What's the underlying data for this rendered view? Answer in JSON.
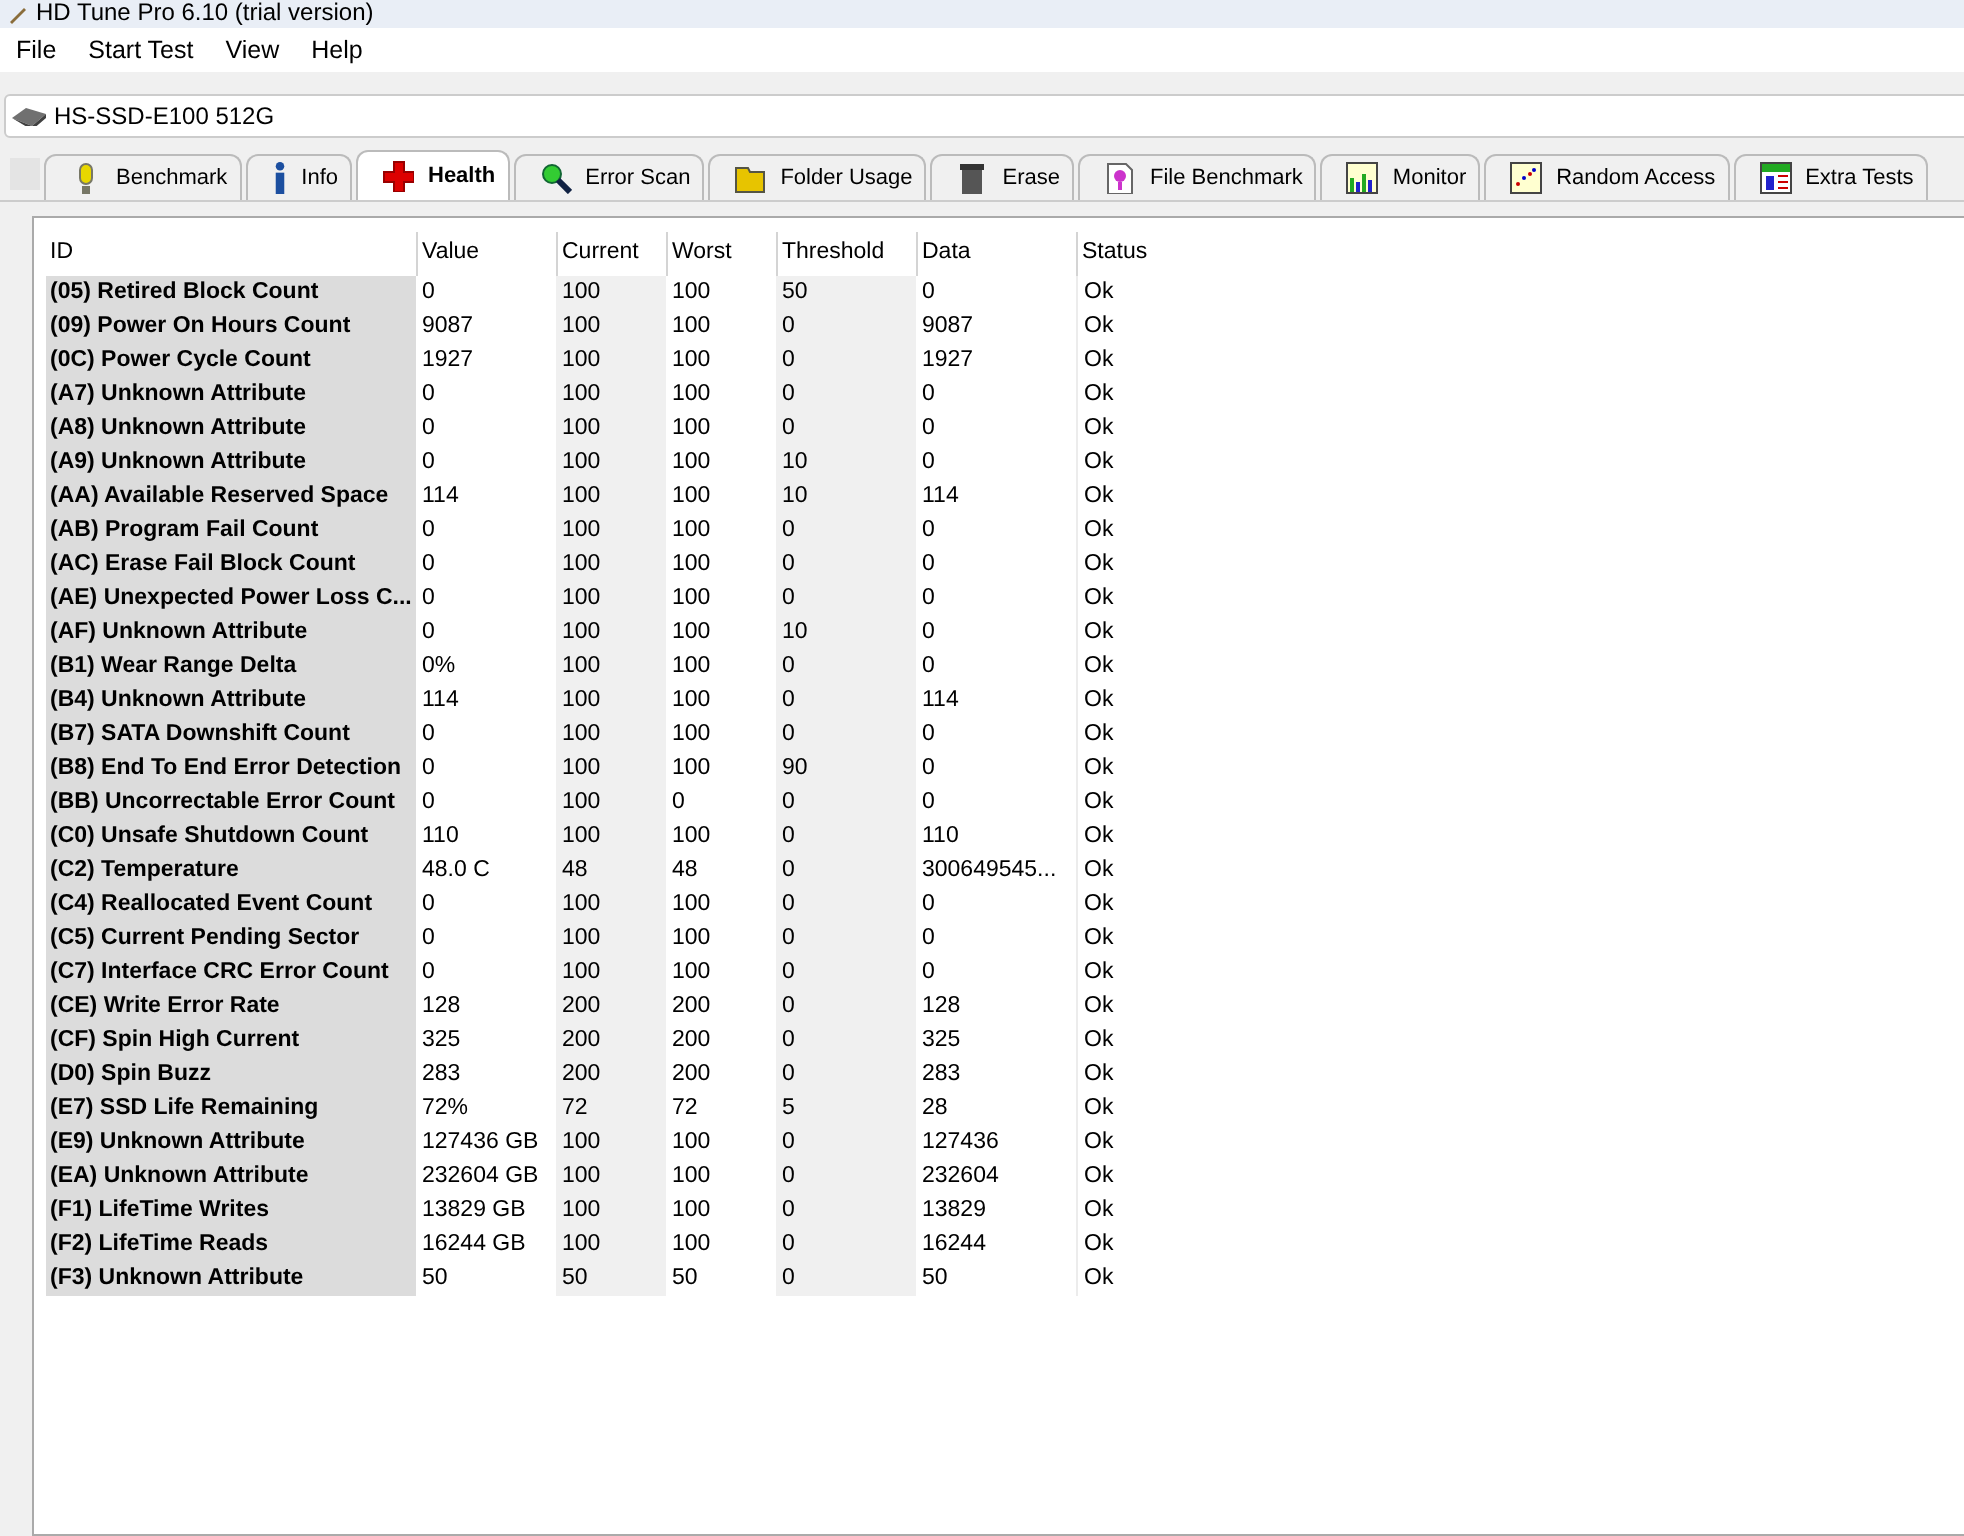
{
  "window": {
    "title": "HD Tune Pro 6.10 (trial version)"
  },
  "menu": [
    "File",
    "Start Test",
    "View",
    "Help"
  ],
  "drive": "HS-SSD-E100 512G",
  "tabs": [
    {
      "label": "Benchmark",
      "selected": false
    },
    {
      "label": "Info",
      "selected": false
    },
    {
      "label": "Health",
      "selected": true
    },
    {
      "label": "Error Scan",
      "selected": false
    },
    {
      "label": "Folder Usage",
      "selected": false
    },
    {
      "label": "Erase",
      "selected": false
    },
    {
      "label": "File Benchmark",
      "selected": false
    },
    {
      "label": "Monitor",
      "selected": false
    },
    {
      "label": "Random Access",
      "selected": false
    },
    {
      "label": "Extra Tests",
      "selected": false
    }
  ],
  "table": {
    "columns": [
      "ID",
      "Value",
      "Current",
      "Worst",
      "Threshold",
      "Data",
      "Status"
    ],
    "rows": [
      [
        "(05) Retired Block Count",
        "0",
        "100",
        "100",
        "50",
        "0",
        "Ok"
      ],
      [
        "(09) Power On Hours Count",
        "9087",
        "100",
        "100",
        "0",
        "9087",
        "Ok"
      ],
      [
        "(0C) Power Cycle Count",
        "1927",
        "100",
        "100",
        "0",
        "1927",
        "Ok"
      ],
      [
        "(A7) Unknown Attribute",
        "0",
        "100",
        "100",
        "0",
        "0",
        "Ok"
      ],
      [
        "(A8) Unknown Attribute",
        "0",
        "100",
        "100",
        "0",
        "0",
        "Ok"
      ],
      [
        "(A9) Unknown Attribute",
        "0",
        "100",
        "100",
        "10",
        "0",
        "Ok"
      ],
      [
        "(AA) Available Reserved Space",
        "114",
        "100",
        "100",
        "10",
        "114",
        "Ok"
      ],
      [
        "(AB) Program Fail Count",
        "0",
        "100",
        "100",
        "0",
        "0",
        "Ok"
      ],
      [
        "(AC) Erase Fail Block Count",
        "0",
        "100",
        "100",
        "0",
        "0",
        "Ok"
      ],
      [
        "(AE) Unexpected Power Loss C...",
        "0",
        "100",
        "100",
        "0",
        "0",
        "Ok"
      ],
      [
        "(AF) Unknown Attribute",
        "0",
        "100",
        "100",
        "10",
        "0",
        "Ok"
      ],
      [
        "(B1) Wear Range Delta",
        "0%",
        "100",
        "100",
        "0",
        "0",
        "Ok"
      ],
      [
        "(B4) Unknown Attribute",
        "114",
        "100",
        "100",
        "0",
        "114",
        "Ok"
      ],
      [
        "(B7) SATA Downshift Count",
        "0",
        "100",
        "100",
        "0",
        "0",
        "Ok"
      ],
      [
        "(B8) End To End Error Detection",
        "0",
        "100",
        "100",
        "90",
        "0",
        "Ok"
      ],
      [
        "(BB) Uncorrectable Error Count",
        "0",
        "100",
        "0",
        "0",
        "0",
        "Ok"
      ],
      [
        "(C0) Unsafe Shutdown Count",
        "110",
        "100",
        "100",
        "0",
        "110",
        "Ok"
      ],
      [
        "(C2) Temperature",
        "48.0 C",
        "48",
        "48",
        "0",
        "300649545...",
        "Ok"
      ],
      [
        "(C4) Reallocated Event Count",
        "0",
        "100",
        "100",
        "0",
        "0",
        "Ok"
      ],
      [
        "(C5) Current Pending Sector",
        "0",
        "100",
        "100",
        "0",
        "0",
        "Ok"
      ],
      [
        "(C7) Interface CRC Error Count",
        "0",
        "100",
        "100",
        "0",
        "0",
        "Ok"
      ],
      [
        "(CE) Write Error Rate",
        "128",
        "200",
        "200",
        "0",
        "128",
        "Ok"
      ],
      [
        "(CF) Spin High Current",
        "325",
        "200",
        "200",
        "0",
        "325",
        "Ok"
      ],
      [
        "(D0) Spin Buzz",
        "283",
        "200",
        "200",
        "0",
        "283",
        "Ok"
      ],
      [
        "(E7) SSD Life Remaining",
        "72%",
        "72",
        "72",
        "5",
        "28",
        "Ok"
      ],
      [
        "(E9) Unknown Attribute",
        "127436 GB",
        "100",
        "100",
        "0",
        "127436",
        "Ok"
      ],
      [
        "(EA) Unknown Attribute",
        "232604 GB",
        "100",
        "100",
        "0",
        "232604",
        "Ok"
      ],
      [
        "(F1) LifeTime Writes",
        "13829 GB",
        "100",
        "100",
        "0",
        "13829",
        "Ok"
      ],
      [
        "(F2) LifeTime Reads",
        "16244 GB",
        "100",
        "100",
        "0",
        "16244",
        "Ok"
      ],
      [
        "(F3) Unknown Attribute",
        "50",
        "50",
        "50",
        "0",
        "50",
        "Ok"
      ]
    ]
  }
}
